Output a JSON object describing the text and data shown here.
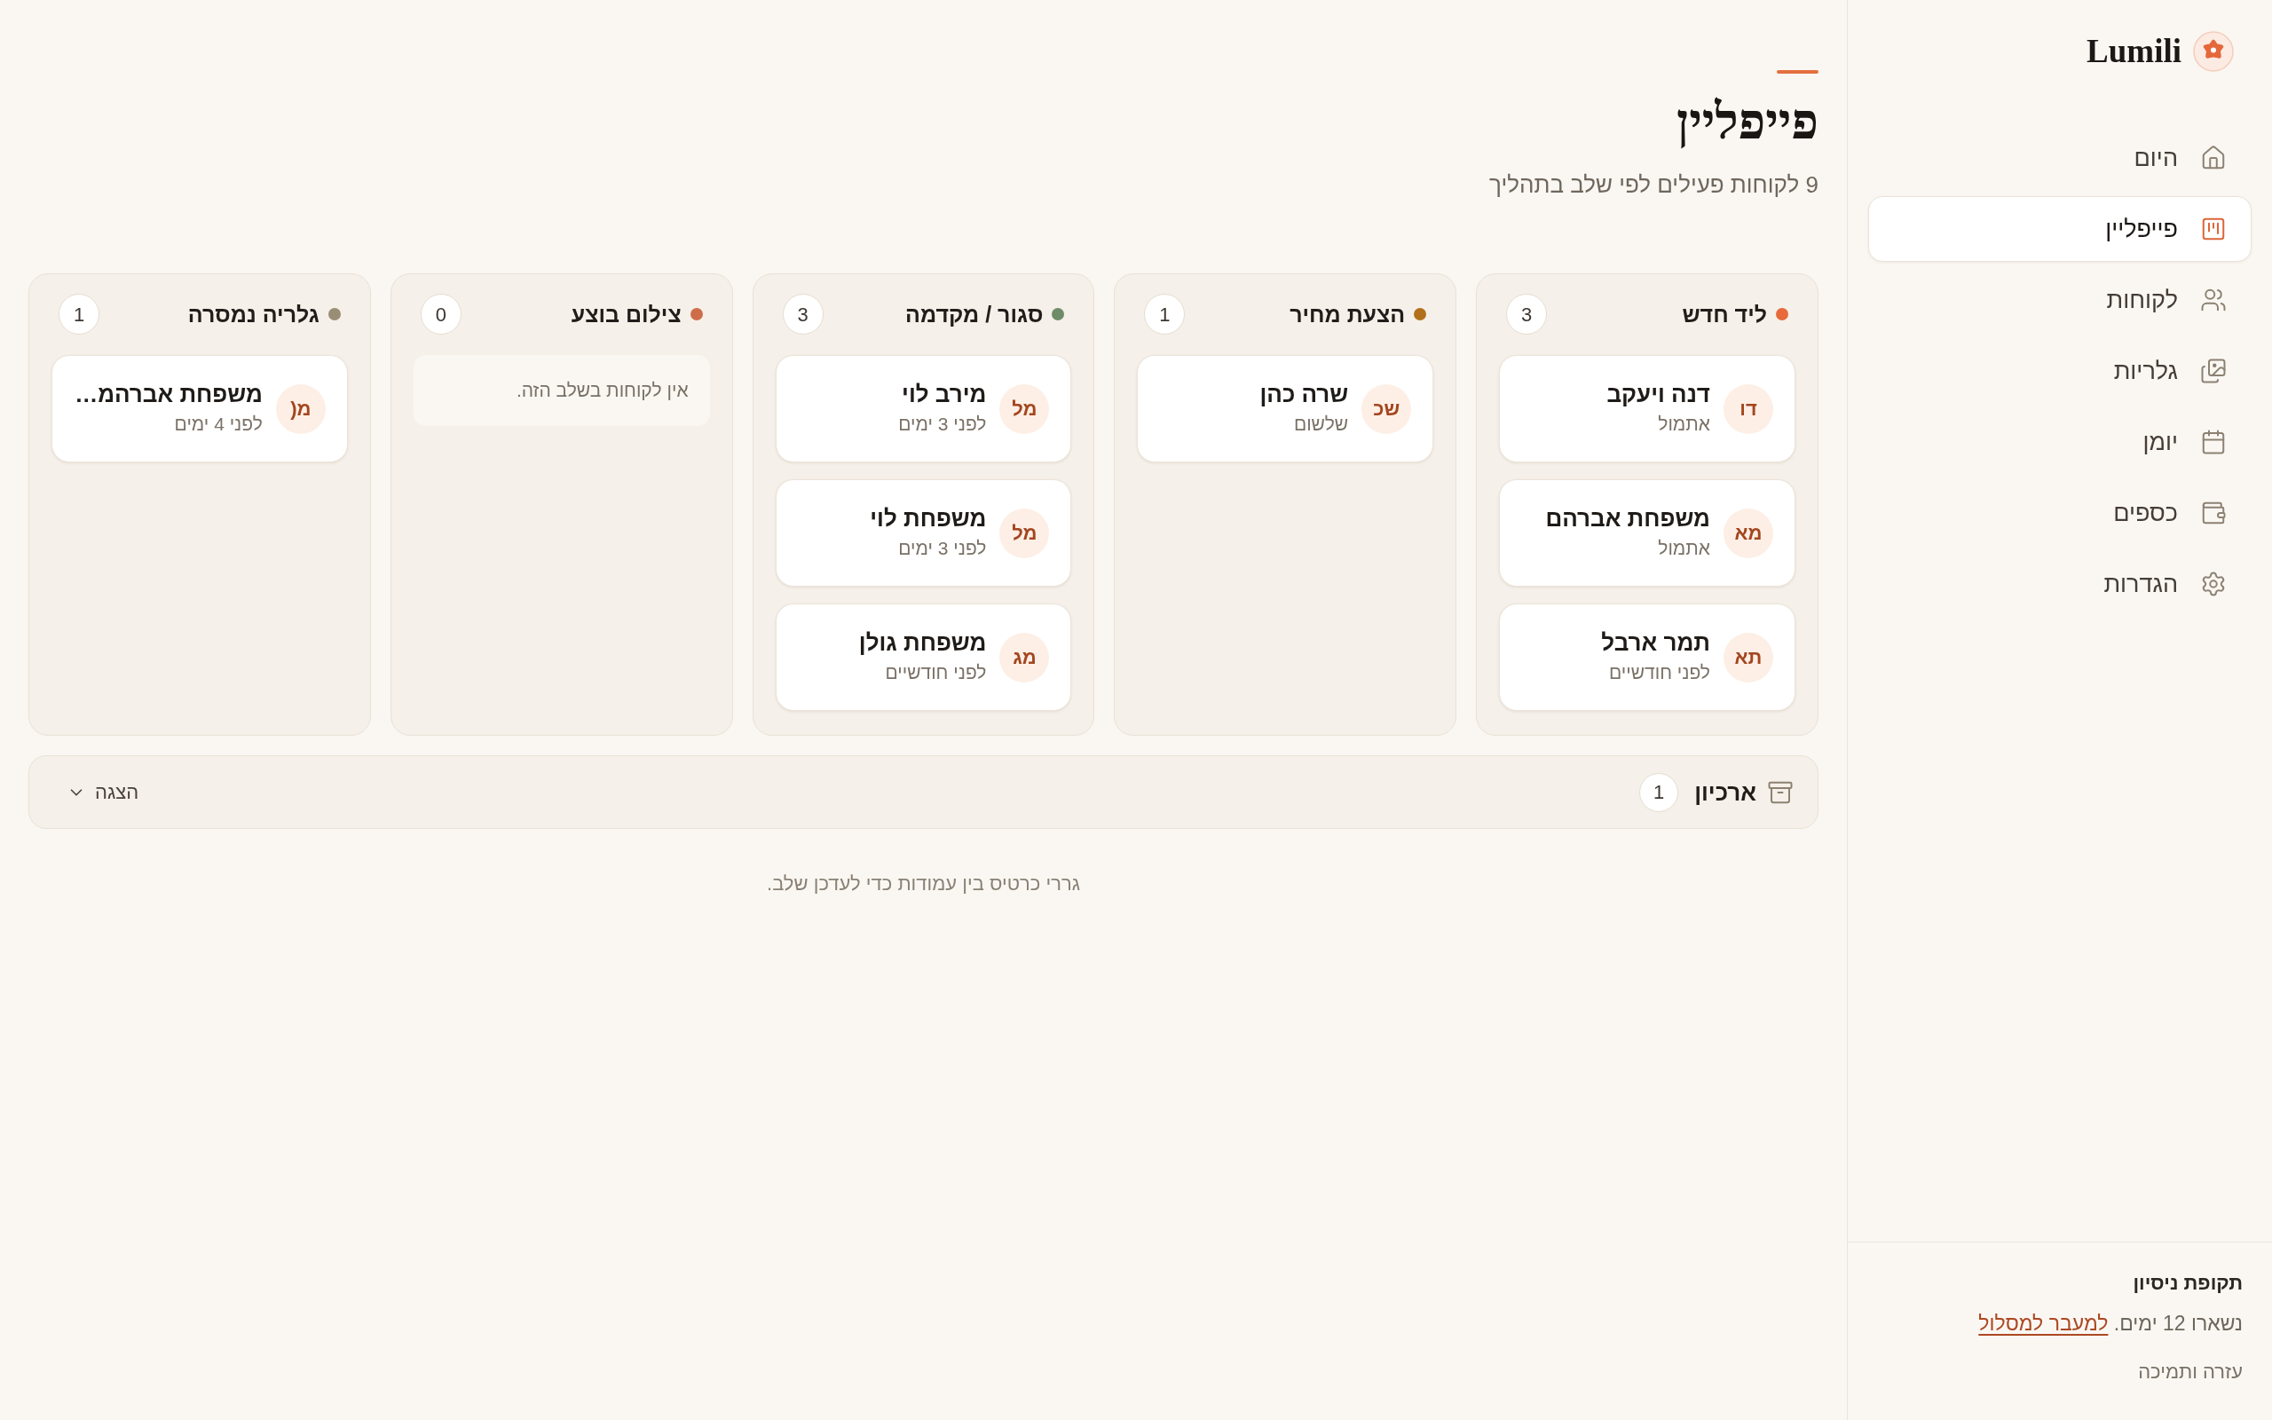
{
  "sidebar": {
    "brand": "Lumili",
    "nav": [
      {
        "label": "היום",
        "selected": false
      },
      {
        "label": "פייפליין",
        "selected": true
      },
      {
        "label": "לקוחות",
        "selected": false
      },
      {
        "label": "גלריות",
        "selected": false
      },
      {
        "label": "יומן",
        "selected": false
      },
      {
        "label": "כספים",
        "selected": false
      },
      {
        "label": "הגדרות",
        "selected": false
      }
    ],
    "trial": {
      "title": "תקופת ניסיון",
      "text": "נשארו 12 ימים.",
      "link": "למעבר למסלול"
    },
    "help": "עזרה ותמיכה"
  },
  "header": {
    "title": "פייפליין",
    "subtitle": "9 לקוחות פעילים לפי שלב בתהליך"
  },
  "columns": [
    {
      "title": "ליד חדש",
      "color": "#e8693c",
      "count": "3",
      "cards": [
        {
          "initials": "דו",
          "name": "דנה ויעקב",
          "time": "אתמול"
        },
        {
          "initials": "מא",
          "name": "משפחת אברהם",
          "time": "אתמול"
        },
        {
          "initials": "תא",
          "name": "תמר ארבל",
          "time": "לפני חודשיים"
        }
      ]
    },
    {
      "title": "הצעת מחיר",
      "color": "#b2701d",
      "count": "1",
      "cards": [
        {
          "initials": "שכ",
          "name": "שרה כהן",
          "time": "שלשום"
        }
      ]
    },
    {
      "title": "סגור / מקדמה",
      "color": "#6f8c68",
      "count": "3",
      "cards": [
        {
          "initials": "מל",
          "name": "מירב לוי",
          "time": "לפני 3 ימים"
        },
        {
          "initials": "מל",
          "name": "משפחת לוי",
          "time": "לפני 3 ימים"
        },
        {
          "initials": "מג",
          "name": "משפחת גולן",
          "time": "לפני חודשיים"
        }
      ]
    },
    {
      "title": "צילום בוצע",
      "color": "#cf6d4a",
      "count": "0",
      "empty": "אין לקוחות בשלב הזה."
    },
    {
      "title": "גלריה נמסרה",
      "color": "#9a8d76",
      "count": "1",
      "cards": [
        {
          "initials": "מ(",
          "name": "משפחת אברהמ…",
          "time": "לפני 4 ימים"
        }
      ]
    }
  ],
  "archive": {
    "title": "ארכיון",
    "count": "1",
    "toggle": "הצגה",
    "expanded": false
  },
  "hint": "גררי כרטיס בין עמודות כדי לעדכן שלב."
}
